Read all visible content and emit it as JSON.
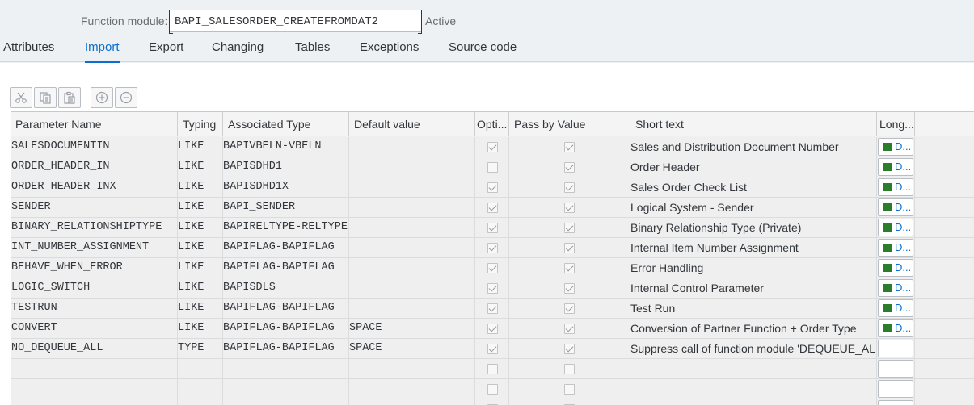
{
  "header": {
    "function_module_label": "Function module:",
    "function_module_value": "BAPI_SALESORDER_CREATEFROMDAT2",
    "status": "Active"
  },
  "tabs": [
    {
      "label": "Attributes",
      "active": false
    },
    {
      "label": "Import",
      "active": true
    },
    {
      "label": "Export",
      "active": false
    },
    {
      "label": "Changing",
      "active": false
    },
    {
      "label": "Tables",
      "active": false
    },
    {
      "label": "Exceptions",
      "active": false
    },
    {
      "label": "Source code",
      "active": false
    }
  ],
  "toolbar": {
    "buttons": [
      "scissors-icon",
      "copy-icon",
      "paste-icon",
      "insert-row-icon",
      "delete-row-icon"
    ]
  },
  "table": {
    "columns": [
      "Parameter Name",
      "Typing",
      "Associated Type",
      "Default value",
      "Opti...",
      "Pass by Value",
      "Short text",
      "Long..."
    ],
    "long_text_label": "D...",
    "rows": [
      {
        "name": "SALESDOCUMENTIN",
        "typing": "LIKE",
        "assoc": "BAPIVBELN-VBELN",
        "default": "",
        "optional": true,
        "pass_by_value": true,
        "short": "Sales and Distribution Document Number",
        "long": true
      },
      {
        "name": "ORDER_HEADER_IN",
        "typing": "LIKE",
        "assoc": "BAPISDHD1",
        "default": "",
        "optional": false,
        "pass_by_value": true,
        "short": "Order Header",
        "long": true
      },
      {
        "name": "ORDER_HEADER_INX",
        "typing": "LIKE",
        "assoc": "BAPISDHD1X",
        "default": "",
        "optional": true,
        "pass_by_value": true,
        "short": "Sales Order Check List",
        "long": true
      },
      {
        "name": "SENDER",
        "typing": "LIKE",
        "assoc": "BAPI_SENDER",
        "default": "",
        "optional": true,
        "pass_by_value": true,
        "short": "Logical System - Sender",
        "long": true
      },
      {
        "name": "BINARY_RELATIONSHIPTYPE",
        "typing": "LIKE",
        "assoc": "BAPIRELTYPE-RELTYPE",
        "default": "",
        "optional": true,
        "pass_by_value": true,
        "short": "Binary Relationship Type (Private)",
        "long": true
      },
      {
        "name": "INT_NUMBER_ASSIGNMENT",
        "typing": "LIKE",
        "assoc": "BAPIFLAG-BAPIFLAG",
        "default": "",
        "optional": true,
        "pass_by_value": true,
        "short": "Internal Item Number Assignment",
        "long": true
      },
      {
        "name": "BEHAVE_WHEN_ERROR",
        "typing": "LIKE",
        "assoc": "BAPIFLAG-BAPIFLAG",
        "default": "",
        "optional": true,
        "pass_by_value": true,
        "short": "Error Handling",
        "long": true
      },
      {
        "name": "LOGIC_SWITCH",
        "typing": "LIKE",
        "assoc": "BAPISDLS",
        "default": "",
        "optional": true,
        "pass_by_value": true,
        "short": "Internal Control Parameter",
        "long": true
      },
      {
        "name": "TESTRUN",
        "typing": "LIKE",
        "assoc": "BAPIFLAG-BAPIFLAG",
        "default": "",
        "optional": true,
        "pass_by_value": true,
        "short": "Test Run",
        "long": true
      },
      {
        "name": "CONVERT",
        "typing": "LIKE",
        "assoc": "BAPIFLAG-BAPIFLAG",
        "default": "SPACE",
        "optional": true,
        "pass_by_value": true,
        "short": "Conversion of Partner Function + Order Type",
        "long": true
      },
      {
        "name": "NO_DEQUEUE_ALL",
        "typing": "TYPE",
        "assoc": "BAPIFLAG-BAPIFLAG",
        "default": "SPACE",
        "optional": true,
        "pass_by_value": true,
        "short": "Suppress call of function module 'DEQUEUE_ALL'",
        "long": false
      },
      {
        "name": "",
        "typing": "",
        "assoc": "",
        "default": "",
        "optional": false,
        "pass_by_value": false,
        "short": "",
        "long": false
      },
      {
        "name": "",
        "typing": "",
        "assoc": "",
        "default": "",
        "optional": false,
        "pass_by_value": false,
        "short": "",
        "long": false
      },
      {
        "name": "",
        "typing": "",
        "assoc": "",
        "default": "",
        "optional": true,
        "pass_by_value": true,
        "short": "",
        "long": false
      }
    ]
  },
  "colors": {
    "accent": "#0a6ed1",
    "long_text_marker": "#2b7d2b"
  }
}
